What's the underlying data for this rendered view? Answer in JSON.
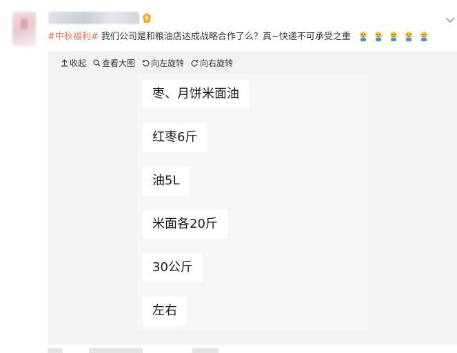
{
  "post": {
    "author_name": "",
    "topic": "#中秋福利#",
    "text": " 我们公司是和粮油店达成战略合作了么？真~快递不可承受之重",
    "emoji_icons": [
      "yawn-emoji-icon",
      "yawn-emoji-icon",
      "yawn-emoji-icon",
      "yawn-emoji-icon",
      "yawn-emoji-icon"
    ]
  },
  "toolbar": {
    "collapse_label": "收起",
    "view_large_label": "查看大图",
    "rotate_left_label": "向左旋转",
    "rotate_right_label": "向右旋转"
  },
  "image_lines": [
    "枣、月饼米面油",
    "红枣6斤",
    "油5L",
    "米面各20斤",
    "30公斤",
    "左右"
  ],
  "colors": {
    "topic": "#eb7350",
    "media_background": "#f2f2f5",
    "bubble_background": "#ffffff"
  }
}
